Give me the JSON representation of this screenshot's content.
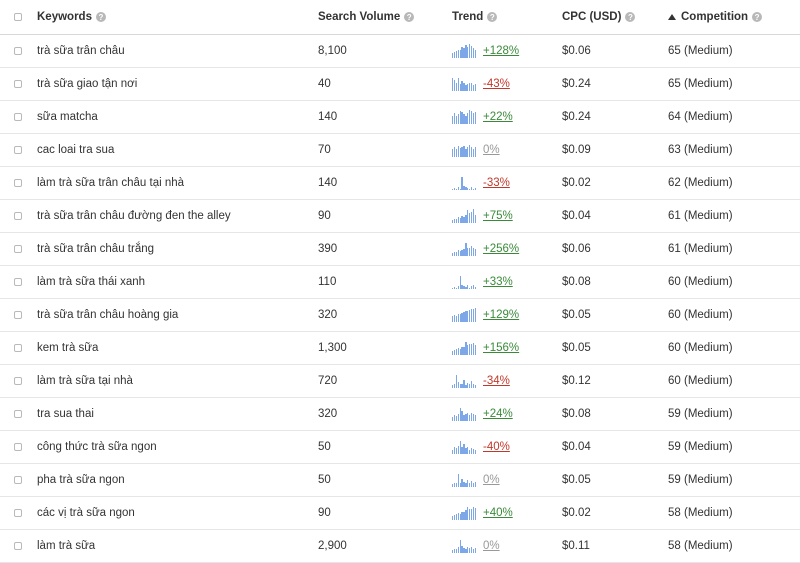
{
  "header": {
    "keywords": "Keywords",
    "search_volume": "Search Volume",
    "trend": "Trend",
    "cpc": "CPC (USD)",
    "competition": "Competition"
  },
  "rows": [
    {
      "keyword": "trà sữa trân châu",
      "volume": "8,100",
      "trend": "+128%",
      "trend_dir": "pos",
      "spark": [
        0.35,
        0.45,
        0.5,
        0.55,
        0.6,
        0.75,
        0.7,
        0.9,
        0.8,
        1.0,
        0.85,
        0.7,
        0.6
      ],
      "cpc": "$0.06",
      "competition": "65 (Medium)"
    },
    {
      "keyword": "trà sữa giao tận nơi",
      "volume": "40",
      "trend": "-43%",
      "trend_dir": "neg",
      "spark": [
        0.9,
        0.8,
        0.6,
        0.9,
        0.5,
        0.7,
        0.6,
        0.4,
        0.5,
        0.6,
        0.55,
        0.4,
        0.5
      ],
      "cpc": "$0.24",
      "competition": "65 (Medium)"
    },
    {
      "keyword": "sữa matcha",
      "volume": "140",
      "trend": "+22%",
      "trend_dir": "pos",
      "spark": [
        0.6,
        0.75,
        0.55,
        0.7,
        0.9,
        0.85,
        0.7,
        0.6,
        0.8,
        1.0,
        0.9,
        0.75,
        0.85
      ],
      "cpc": "$0.24",
      "competition": "64 (Medium)"
    },
    {
      "keyword": "cac loai tra sua",
      "volume": "70",
      "trend": "0%",
      "trend_dir": "zero",
      "spark": [
        0.6,
        0.7,
        0.55,
        0.8,
        0.65,
        0.7,
        0.75,
        0.6,
        0.7,
        0.85,
        0.7,
        0.6,
        0.7
      ],
      "cpc": "$0.09",
      "competition": "63 (Medium)"
    },
    {
      "keyword": "làm trà sữa trân châu tại nhà",
      "volume": "140",
      "trend": "-33%",
      "trend_dir": "neg",
      "spark": [
        0.1,
        0.15,
        0.1,
        0.2,
        0.1,
        0.9,
        0.3,
        0.2,
        0.15,
        0.1,
        0.2,
        0.1,
        0.15
      ],
      "cpc": "$0.02",
      "competition": "62 (Medium)"
    },
    {
      "keyword": "trà sữa trân châu đường đen the alley",
      "volume": "90",
      "trend": "+75%",
      "trend_dir": "pos",
      "spark": [
        0.2,
        0.3,
        0.25,
        0.4,
        0.35,
        0.5,
        0.45,
        0.6,
        0.9,
        0.7,
        0.8,
        1.0,
        0.6
      ],
      "cpc": "$0.04",
      "competition": "61 (Medium)"
    },
    {
      "keyword": "trà sữa trân châu trắng",
      "volume": "390",
      "trend": "+256%",
      "trend_dir": "pos",
      "spark": [
        0.2,
        0.25,
        0.3,
        0.4,
        0.35,
        0.45,
        0.5,
        0.9,
        0.6,
        0.55,
        0.7,
        0.6,
        0.5
      ],
      "cpc": "$0.06",
      "competition": "61 (Medium)"
    },
    {
      "keyword": "làm trà sữa thái xanh",
      "volume": "110",
      "trend": "+33%",
      "trend_dir": "pos",
      "spark": [
        0.1,
        0.15,
        0.1,
        0.2,
        0.9,
        0.3,
        0.2,
        0.15,
        0.25,
        0.1,
        0.2,
        0.3,
        0.15
      ],
      "cpc": "$0.08",
      "competition": "60 (Medium)"
    },
    {
      "keyword": "trà sữa trân châu hoàng gia",
      "volume": "320",
      "trend": "+129%",
      "trend_dir": "pos",
      "spark": [
        0.4,
        0.5,
        0.45,
        0.55,
        0.6,
        0.65,
        0.7,
        0.75,
        0.8,
        0.85,
        0.9,
        0.95,
        1.0
      ],
      "cpc": "$0.05",
      "competition": "60 (Medium)"
    },
    {
      "keyword": "kem trà sữa",
      "volume": "1,300",
      "trend": "+156%",
      "trend_dir": "pos",
      "spark": [
        0.3,
        0.35,
        0.4,
        0.5,
        0.45,
        0.55,
        0.6,
        0.9,
        0.7,
        0.75,
        0.8,
        0.85,
        0.7
      ],
      "cpc": "$0.05",
      "competition": "60 (Medium)"
    },
    {
      "keyword": "làm trà sữa tại nhà",
      "volume": "720",
      "trend": "-34%",
      "trend_dir": "neg",
      "spark": [
        0.2,
        0.3,
        0.9,
        0.4,
        0.25,
        0.3,
        0.6,
        0.2,
        0.35,
        0.25,
        0.5,
        0.3,
        0.2
      ],
      "cpc": "$0.12",
      "competition": "60 (Medium)"
    },
    {
      "keyword": "tra sua thai",
      "volume": "320",
      "trend": "+24%",
      "trend_dir": "pos",
      "spark": [
        0.3,
        0.4,
        0.35,
        0.5,
        0.9,
        0.7,
        0.45,
        0.5,
        0.6,
        0.4,
        0.55,
        0.5,
        0.45
      ],
      "cpc": "$0.08",
      "competition": "59 (Medium)"
    },
    {
      "keyword": "công thức trà sữa ngon",
      "volume": "50",
      "trend": "-40%",
      "trend_dir": "neg",
      "spark": [
        0.3,
        0.5,
        0.4,
        0.6,
        0.9,
        0.5,
        0.7,
        0.4,
        0.5,
        0.3,
        0.4,
        0.35,
        0.3
      ],
      "cpc": "$0.04",
      "competition": "59 (Medium)"
    },
    {
      "keyword": "pha trà sữa ngon",
      "volume": "50",
      "trend": "0%",
      "trend_dir": "zero",
      "spark": [
        0.2,
        0.3,
        0.25,
        0.9,
        0.3,
        0.6,
        0.35,
        0.25,
        0.5,
        0.3,
        0.4,
        0.3,
        0.35
      ],
      "cpc": "$0.05",
      "competition": "59 (Medium)"
    },
    {
      "keyword": "các vị trà sữa ngon",
      "volume": "90",
      "trend": "+40%",
      "trend_dir": "pos",
      "spark": [
        0.3,
        0.35,
        0.4,
        0.5,
        0.45,
        0.55,
        0.6,
        0.7,
        0.9,
        0.75,
        0.8,
        0.95,
        0.85
      ],
      "cpc": "$0.02",
      "competition": "58 (Medium)"
    },
    {
      "keyword": "làm trà sữa",
      "volume": "2,900",
      "trend": "0%",
      "trend_dir": "zero",
      "spark": [
        0.2,
        0.3,
        0.25,
        0.4,
        0.9,
        0.5,
        0.35,
        0.3,
        0.45,
        0.35,
        0.4,
        0.3,
        0.35
      ],
      "cpc": "$0.11",
      "competition": "58 (Medium)"
    }
  ]
}
